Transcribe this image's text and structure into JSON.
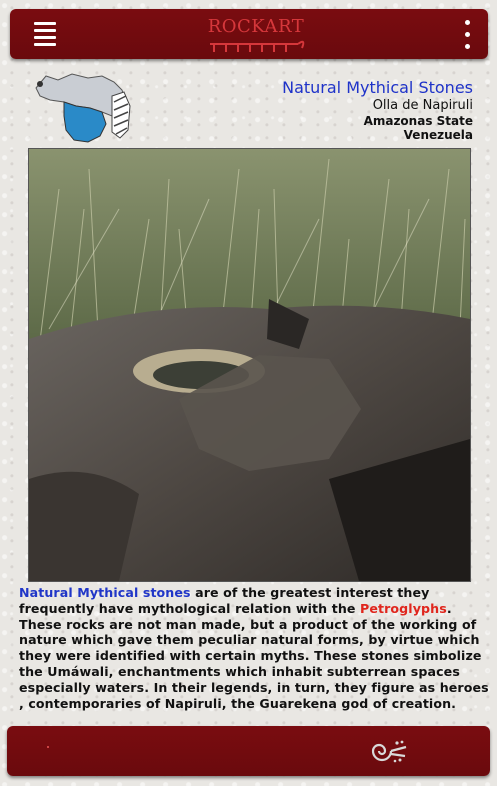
{
  "header": {
    "logo_text": "ROCKART",
    "menu_icon": "hamburger-menu-icon",
    "more_icon": "vertical-dots-icon",
    "bar_color": "#730b0f"
  },
  "title_block": {
    "title": "Natural Mythical Stones",
    "site": "Olla de Napiruli",
    "state": "Amazonas State",
    "country": "Venezuela",
    "title_color": "#1f33c9"
  },
  "description": {
    "link_blue": "Natural Mythical stones",
    "text_1": " are of the greatest interest they frequently have mythological relation with the ",
    "link_red": "Petroglyphs",
    "text_2": ". These rocks are not man made, but a product of the working of nature which gave them peculiar natural forms, by virtue which they were  identified with certain myths. These stones simbolize the Umáwali, enchantments which inhabit subterrean spaces especially waters. In their legends, in turn, they figure as heroes , contemporaries of Napiruli, the Guarekena god of creation."
  },
  "footer": {
    "icon": "petroglyph-spiral-icon"
  }
}
